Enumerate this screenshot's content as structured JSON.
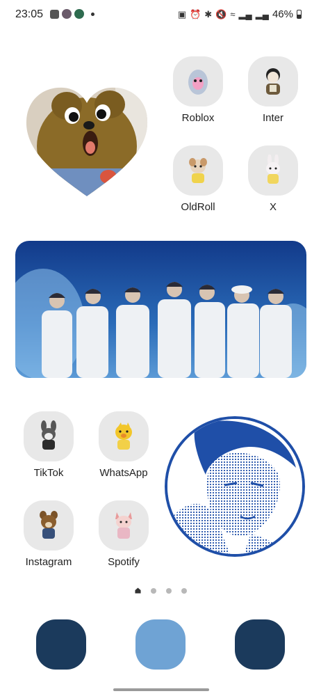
{
  "status_bar": {
    "time": "23:05",
    "battery": "46%"
  },
  "apps": {
    "roblox": "Roblox",
    "inter": "Inter",
    "oldroll": "OldRoll",
    "x": "X",
    "tiktok": "TikTok",
    "whatsapp": "WhatsApp",
    "instagram": "Instagram",
    "spotify": "Spotify"
  },
  "page_indicator": {
    "count": 4,
    "current": 1
  },
  "dock": {
    "colors": [
      "#1b3a5c",
      "#6fa3d4",
      "#1b3a5c"
    ]
  },
  "colors": {
    "tile": "#e8e8e8",
    "portrait_border": "#1f4fa8",
    "banner_blue": "#1c4e9b"
  }
}
